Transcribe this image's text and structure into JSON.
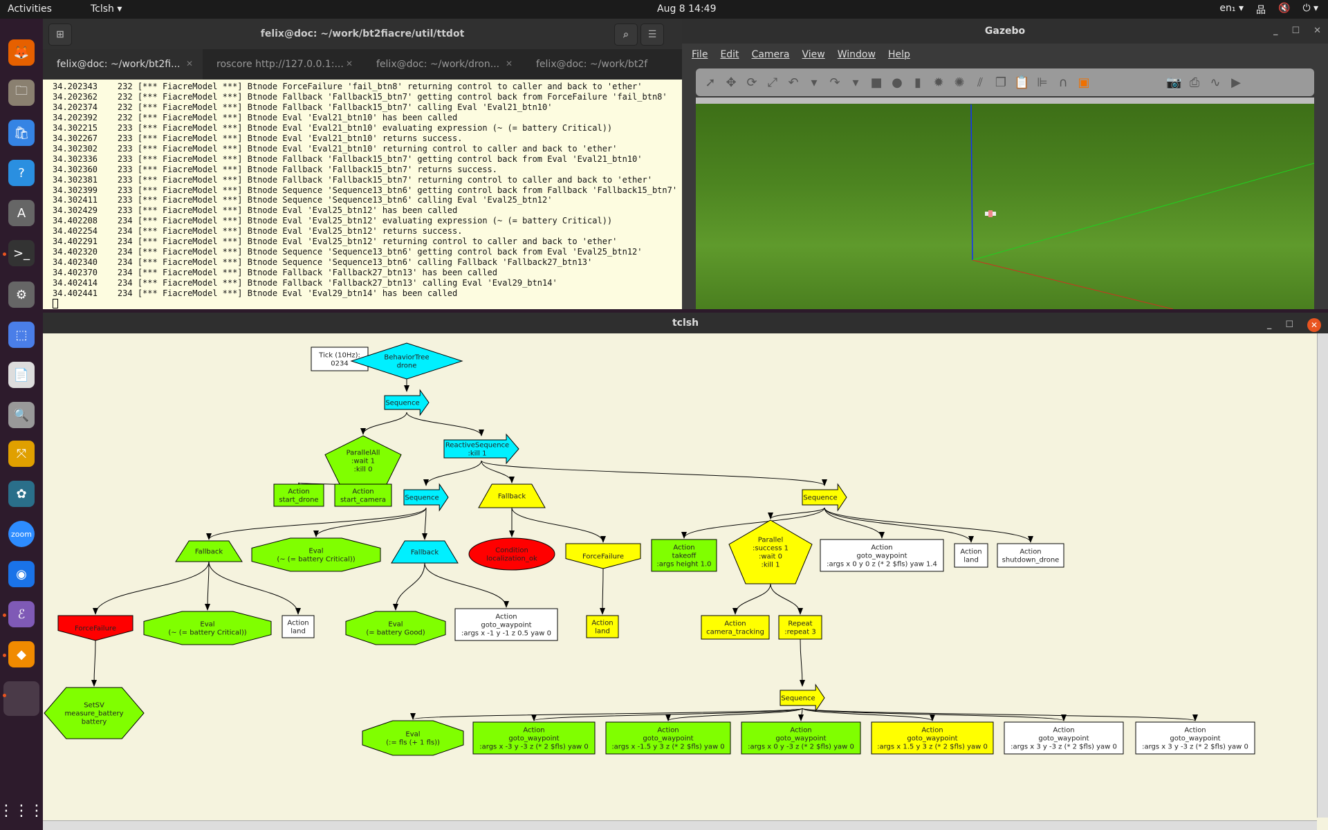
{
  "topbar": {
    "activities": "Activities",
    "app_menu": "Tclsh ▾",
    "clock": "Aug 8  14:49",
    "lang": "en₁ ▾",
    "net": "品",
    "sound": "🔇",
    "power": "⏻ ▾"
  },
  "dock": {
    "items": [
      {
        "name": "firefox",
        "glyph": "🦊",
        "color": "#e66000",
        "running": false
      },
      {
        "name": "files",
        "glyph": "🗀",
        "color": "#8a8070",
        "running": false
      },
      {
        "name": "software",
        "glyph": "🛍",
        "color": "#3584e4",
        "running": false
      },
      {
        "name": "help",
        "glyph": "?",
        "color": "#2a8fe0",
        "running": false
      },
      {
        "name": "software-updater",
        "glyph": "A",
        "color": "#666",
        "running": false
      },
      {
        "name": "terminal",
        "glyph": ">_",
        "color": "#333",
        "running": true
      },
      {
        "name": "settings",
        "glyph": "⚙",
        "color": "#666",
        "running": false
      },
      {
        "name": "screenshot",
        "glyph": "⬚",
        "color": "#4a7ee8",
        "running": false
      },
      {
        "name": "document-viewer",
        "glyph": "📄",
        "color": "#ddd",
        "running": false
      },
      {
        "name": "image-viewer",
        "glyph": "🔍",
        "color": "#999",
        "running": false
      },
      {
        "name": "yed",
        "glyph": "⤧",
        "color": "#e0a000",
        "running": false
      },
      {
        "name": "inkscape-app",
        "glyph": "✿",
        "color": "#2a6f8a",
        "running": false
      },
      {
        "name": "zoom",
        "glyph": "zoom",
        "color": "#2d8cff",
        "running": false
      },
      {
        "name": "chrome",
        "glyph": "◉",
        "color": "#1a73e8",
        "running": false
      },
      {
        "name": "emacs",
        "glyph": "ℰ",
        "color": "#7f5ab6",
        "running": true
      },
      {
        "name": "gazebo",
        "glyph": "◆",
        "color": "#f08a00",
        "running": true
      },
      {
        "name": "tclsh",
        "glyph": "",
        "color": "#4a3a48",
        "running": true
      }
    ],
    "apps_grid": "⋮⋮⋮"
  },
  "terminal": {
    "title": "felix@doc: ~/work/bt2fiacre/util/ttdot",
    "tabs": [
      {
        "label": "felix@doc: ~/work/bt2fi...",
        "active": true
      },
      {
        "label": "roscore http://127.0.0.1:...",
        "active": false
      },
      {
        "label": "felix@doc: ~/work/dron...",
        "active": false
      },
      {
        "label": "felix@doc: ~/work/bt2f",
        "active": false
      }
    ],
    "lines": [
      "34.202343    232 [*** FiacreModel ***] Btnode ForceFailure 'fail_btn8' returning control to caller and back to 'ether'",
      "34.202362    232 [*** FiacreModel ***] Btnode Fallback 'Fallback15_btn7' getting control back from ForceFailure 'fail_btn8'",
      "34.202374    232 [*** FiacreModel ***] Btnode Fallback 'Fallback15_btn7' calling Eval 'Eval21_btn10'",
      "34.202392    232 [*** FiacreModel ***] Btnode Eval 'Eval21_btn10' has been called",
      "34.302215    233 [*** FiacreModel ***] Btnode Eval 'Eval21_btn10' evaluating expression (~ (= battery Critical))",
      "34.302267    233 [*** FiacreModel ***] Btnode Eval 'Eval21_btn10' returns success.",
      "34.302302    233 [*** FiacreModel ***] Btnode Eval 'Eval21_btn10' returning control to caller and back to 'ether'",
      "34.302336    233 [*** FiacreModel ***] Btnode Fallback 'Fallback15_btn7' getting control back from Eval 'Eval21_btn10'",
      "34.302360    233 [*** FiacreModel ***] Btnode Fallback 'Fallback15_btn7' returns success.",
      "34.302381    233 [*** FiacreModel ***] Btnode Fallback 'Fallback15_btn7' returning control to caller and back to 'ether'",
      "34.302399    233 [*** FiacreModel ***] Btnode Sequence 'Sequence13_btn6' getting control back from Fallback 'Fallback15_btn7'",
      "34.302411    233 [*** FiacreModel ***] Btnode Sequence 'Sequence13_btn6' calling Eval 'Eval25_btn12'",
      "34.302429    233 [*** FiacreModel ***] Btnode Eval 'Eval25_btn12' has been called",
      "34.402208    234 [*** FiacreModel ***] Btnode Eval 'Eval25_btn12' evaluating expression (~ (= battery Critical))",
      "34.402254    234 [*** FiacreModel ***] Btnode Eval 'Eval25_btn12' returns success.",
      "34.402291    234 [*** FiacreModel ***] Btnode Eval 'Eval25_btn12' returning control to caller and back to 'ether'",
      "34.402320    234 [*** FiacreModel ***] Btnode Sequence 'Sequence13_btn6' getting control back from Eval 'Eval25_btn12'",
      "34.402340    234 [*** FiacreModel ***] Btnode Sequence 'Sequence13_btn6' calling Fallback 'Fallback27_btn13'",
      "34.402370    234 [*** FiacreModel ***] Btnode Fallback 'Fallback27_btn13' has been called",
      "34.402414    234 [*** FiacreModel ***] Btnode Fallback 'Fallback27_btn13' calling Eval 'Eval29_btn14'",
      "34.402441    234 [*** FiacreModel ***] Btnode Eval 'Eval29_btn14' has been called"
    ]
  },
  "gazebo": {
    "title": "Gazebo",
    "menu": [
      "File",
      "Edit",
      "Camera",
      "View",
      "Window",
      "Help"
    ],
    "tools": [
      "select-arrow",
      "translate",
      "rotate",
      "scale",
      "undo",
      "undo-menu",
      "redo",
      "redo-menu",
      "box",
      "sphere",
      "cylinder",
      "point-light",
      "spot-light",
      "directional-light",
      "copy",
      "paste",
      "align",
      "snap",
      "view-angle",
      "screenshot",
      "log",
      "plot",
      "video"
    ]
  },
  "tclsh": {
    "title": "tclsh",
    "colors": {
      "cyan": "#00f0ff",
      "green": "#80ff00",
      "yellow": "#ffff00",
      "red": "#ff0000",
      "white": "#ffffff"
    },
    "nodes": [
      {
        "id": "tick",
        "shape": "box",
        "color": "white",
        "lines": [
          "Tick (10Hz):",
          "0234"
        ]
      },
      {
        "id": "root",
        "shape": "diamond",
        "color": "cyan",
        "lines": [
          "BehaviorTree",
          "drone"
        ]
      },
      {
        "id": "seq1",
        "shape": "arrow",
        "color": "cyan",
        "lines": [
          "Sequence"
        ]
      },
      {
        "id": "par",
        "shape": "pentagon",
        "color": "green",
        "lines": [
          "ParallelAll",
          ":wait 1",
          ":kill 0"
        ]
      },
      {
        "id": "rseq",
        "shape": "arrow",
        "color": "cyan",
        "lines": [
          "ReactiveSequence",
          ":kill 1"
        ]
      },
      {
        "id": "a_start",
        "shape": "box",
        "color": "green",
        "lines": [
          "Action",
          "start_drone"
        ]
      },
      {
        "id": "a_cam",
        "shape": "box",
        "color": "green",
        "lines": [
          "Action",
          "start_camera"
        ]
      },
      {
        "id": "seq2",
        "shape": "arrow",
        "color": "cyan",
        "lines": [
          "Sequence"
        ]
      },
      {
        "id": "fb1",
        "shape": "trap",
        "color": "yellow",
        "lines": [
          "Fallback"
        ]
      },
      {
        "id": "seq3",
        "shape": "arrow",
        "color": "yellow",
        "lines": [
          "Sequence"
        ]
      },
      {
        "id": "fbL",
        "shape": "trap",
        "color": "green",
        "lines": [
          "Fallback"
        ]
      },
      {
        "id": "evalC1",
        "shape": "octagon",
        "color": "green",
        "lines": [
          "Eval",
          "(~ (= battery Critical))"
        ]
      },
      {
        "id": "fbC",
        "shape": "trap",
        "color": "cyan",
        "lines": [
          "Fallback"
        ]
      },
      {
        "id": "cond",
        "shape": "ellipse",
        "color": "red",
        "lines": [
          "Condition",
          "localization_ok"
        ]
      },
      {
        "id": "ff1",
        "shape": "invhouse",
        "color": "yellow",
        "lines": [
          "ForceFailure"
        ]
      },
      {
        "id": "takeoff",
        "shape": "box",
        "color": "green",
        "lines": [
          "Action",
          "takeoff",
          ":args height 1.0"
        ]
      },
      {
        "id": "par2",
        "shape": "pentagon",
        "color": "yellow",
        "lines": [
          "Parallel",
          ":success 1",
          ":wait 0",
          ":kill 1"
        ]
      },
      {
        "id": "gw0",
        "shape": "box",
        "color": "white",
        "lines": [
          "Action",
          "goto_waypoint",
          ":args x 0 y 0 z (* 2 $fls) yaw 1.4"
        ]
      },
      {
        "id": "land2",
        "shape": "box",
        "color": "white",
        "lines": [
          "Action",
          "land"
        ]
      },
      {
        "id": "shut",
        "shape": "box",
        "color": "white",
        "lines": [
          "Action",
          "shutdown_drone"
        ]
      },
      {
        "id": "ffR",
        "shape": "invhouse",
        "color": "red",
        "lines": [
          "ForceFailure"
        ]
      },
      {
        "id": "evalC2",
        "shape": "octagon",
        "color": "green",
        "lines": [
          "Eval",
          "(~ (= battery Critical))"
        ]
      },
      {
        "id": "land1",
        "shape": "box",
        "color": "white",
        "lines": [
          "Action",
          "land"
        ]
      },
      {
        "id": "evalG",
        "shape": "octagon",
        "color": "green",
        "lines": [
          "Eval",
          "(= battery Good)"
        ]
      },
      {
        "id": "gwA",
        "shape": "box",
        "color": "white",
        "lines": [
          "Action",
          "goto_waypoint",
          ":args x -1 y -1 z 0.5 yaw 0"
        ]
      },
      {
        "id": "land3",
        "shape": "box",
        "color": "yellow",
        "lines": [
          "Action",
          "land"
        ]
      },
      {
        "id": "camtr",
        "shape": "box",
        "color": "yellow",
        "lines": [
          "Action",
          "camera_tracking"
        ]
      },
      {
        "id": "rep",
        "shape": "box",
        "color": "yellow",
        "lines": [
          "Repeat",
          ":repeat 3"
        ]
      },
      {
        "id": "setsv",
        "shape": "hexagon",
        "color": "green",
        "lines": [
          "SetSV",
          "measure_battery",
          "battery"
        ]
      },
      {
        "id": "seq4",
        "shape": "arrow",
        "color": "yellow",
        "lines": [
          "Sequence"
        ]
      },
      {
        "id": "evalF",
        "shape": "octagon",
        "color": "green",
        "lines": [
          "Eval",
          "(:= fls (+ 1 fls))"
        ]
      },
      {
        "id": "w1",
        "shape": "box",
        "color": "green",
        "lines": [
          "Action",
          "goto_waypoint",
          ":args x -3 y -3 z (* 2 $fls) yaw 0"
        ]
      },
      {
        "id": "w2",
        "shape": "box",
        "color": "green",
        "lines": [
          "Action",
          "goto_waypoint",
          ":args x -1.5 y 3 z (* 2 $fls) yaw 0"
        ]
      },
      {
        "id": "w3",
        "shape": "box",
        "color": "green",
        "lines": [
          "Action",
          "goto_waypoint",
          ":args x 0 y -3 z (* 2 $fls) yaw 0"
        ]
      },
      {
        "id": "w4",
        "shape": "box",
        "color": "yellow",
        "lines": [
          "Action",
          "goto_waypoint",
          ":args x 1.5 y 3 z (* 2 $fls) yaw 0"
        ]
      },
      {
        "id": "w5",
        "shape": "box",
        "color": "white",
        "lines": [
          "Action",
          "goto_waypoint",
          ":args x 3 y -3 z (* 2 $fls) yaw 0"
        ]
      },
      {
        "id": "w6",
        "shape": "box",
        "color": "white",
        "lines": [
          "Action",
          "goto_waypoint",
          ":args x 3 y -3 z (* 2 $fls) yaw 0"
        ]
      }
    ],
    "edges": [
      [
        "root",
        "seq1"
      ],
      [
        "seq1",
        "par"
      ],
      [
        "seq1",
        "rseq"
      ],
      [
        "par",
        "a_start"
      ],
      [
        "par",
        "a_cam"
      ],
      [
        "rseq",
        "seq2"
      ],
      [
        "rseq",
        "fb1"
      ],
      [
        "rseq",
        "seq3"
      ],
      [
        "seq2",
        "fbL"
      ],
      [
        "seq2",
        "evalC1"
      ],
      [
        "seq2",
        "fbC"
      ],
      [
        "fb1",
        "cond"
      ],
      [
        "fb1",
        "ff1"
      ],
      [
        "ff1",
        "land3"
      ],
      [
        "seq3",
        "takeoff"
      ],
      [
        "seq3",
        "par2"
      ],
      [
        "seq3",
        "gw0"
      ],
      [
        "seq3",
        "land2"
      ],
      [
        "seq3",
        "shut"
      ],
      [
        "fbL",
        "ffR"
      ],
      [
        "fbL",
        "evalC2"
      ],
      [
        "fbL",
        "land1"
      ],
      [
        "ffR",
        "setsv"
      ],
      [
        "fbC",
        "evalG"
      ],
      [
        "fbC",
        "gwA"
      ],
      [
        "par2",
        "camtr"
      ],
      [
        "par2",
        "rep"
      ],
      [
        "rep",
        "seq4"
      ],
      [
        "seq4",
        "evalF"
      ],
      [
        "seq4",
        "w1"
      ],
      [
        "seq4",
        "w2"
      ],
      [
        "seq4",
        "w3"
      ],
      [
        "seq4",
        "w4"
      ],
      [
        "seq4",
        "w5"
      ],
      [
        "seq4",
        "w6"
      ]
    ]
  }
}
